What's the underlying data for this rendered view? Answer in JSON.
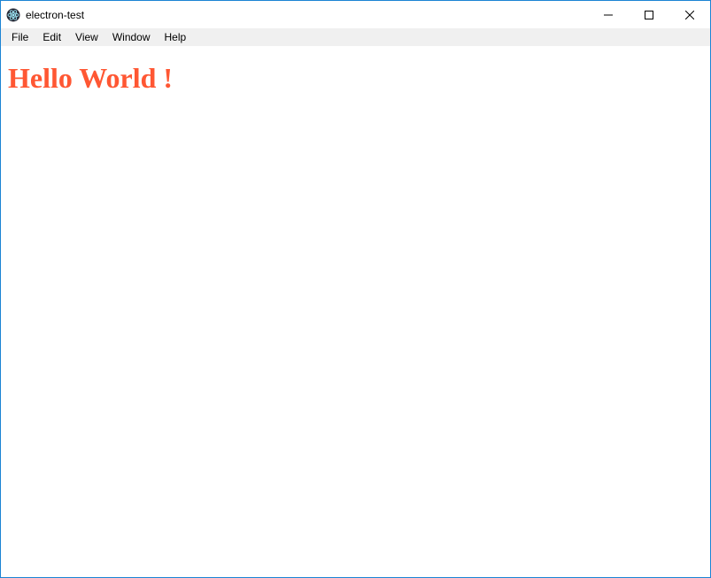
{
  "titlebar": {
    "title": "electron-test"
  },
  "menubar": {
    "items": [
      {
        "label": "File"
      },
      {
        "label": "Edit"
      },
      {
        "label": "View"
      },
      {
        "label": "Window"
      },
      {
        "label": "Help"
      }
    ]
  },
  "content": {
    "heading": "Hello World !"
  }
}
